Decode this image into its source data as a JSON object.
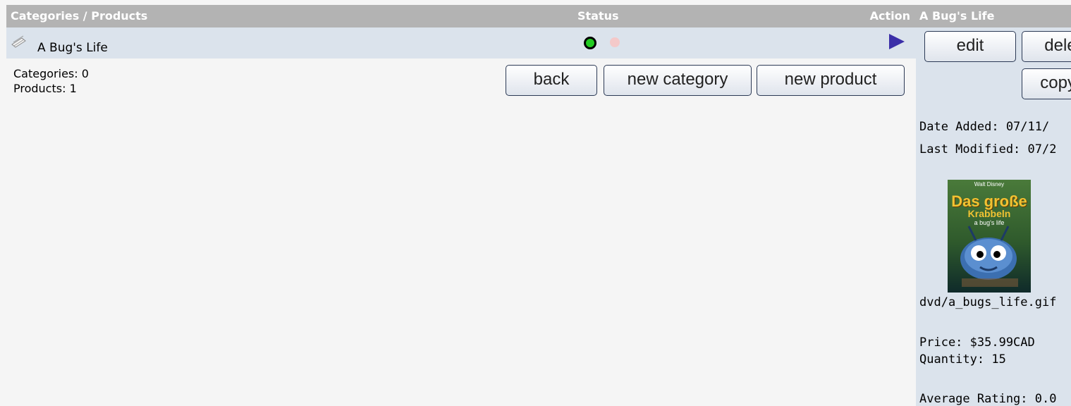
{
  "listing": {
    "header": {
      "categories_products": "Categories / Products",
      "status": "Status",
      "action": "Action"
    },
    "rows": [
      {
        "name": "A Bug's Life",
        "icon": "product-icon",
        "status_active": true,
        "status_active_color": "#22cc22",
        "status_inactive_color": "#f4c9c9"
      }
    ],
    "counts": {
      "categories": "Categories: 0",
      "products": "Products: 1"
    },
    "buttons": {
      "back": "back",
      "new_category": "new category",
      "new_product": "new product"
    }
  },
  "info_panel": {
    "title": "A Bug's Life",
    "buttons": {
      "edit": "edit",
      "delete": "delete",
      "copy": "copy to"
    },
    "date_added": "Date Added: 07/11/",
    "last_modified": "Last Modified: 07/2",
    "image_file": "dvd/a_bugs_life.gif",
    "image_cover": {
      "top": "Walt Disney",
      "line1": "Das große",
      "line2": "Krabbeln",
      "line3": "a bug's life"
    },
    "price": "Price: $35.99CAD",
    "quantity": "Quantity: 15",
    "average_rating": "Average Rating: 0.0"
  },
  "colors": {
    "header_bg": "#b3b3b3",
    "row_bg": "#dbe3ec",
    "action_arrow": "#3b2fa8",
    "page_bg": "#f5f5f5"
  }
}
